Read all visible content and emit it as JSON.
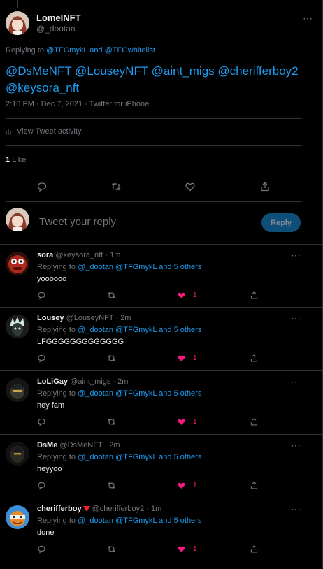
{
  "colors": {
    "accent": "#1d9bf0",
    "like": "#f91880",
    "muted": "#71767b",
    "text": "#e7e9ea",
    "background": "#000000"
  },
  "main_tweet": {
    "author_name": "LomeINFT",
    "author_handle": "@_dootan",
    "replying_prefix": "Replying to",
    "replying_targets": "@TFGmykL and @TFGwhitelist",
    "text_line1": "@DsMeNFT @LouseyNFT @aint_migs @cherifferboy2",
    "text_line2": "@keysora_nft",
    "meta": "2:10 PM · Dec 7, 2021 · Twitter for iPhone",
    "activity_label": "View Tweet activity",
    "like_count": "1",
    "like_label": "Like",
    "more_icon": "⋯"
  },
  "actions": {
    "reply_icon": "reply-icon",
    "retweet_icon": "retweet-icon",
    "like_icon": "heart-icon",
    "share_icon": "share-icon"
  },
  "composer": {
    "placeholder": "Tweet your reply",
    "button_label": "Reply"
  },
  "replies": [
    {
      "name": "sora",
      "handle": "@keysora_nft",
      "time": "· 1m",
      "replying_prefix": "Replying to",
      "replying_targets": "@_dootan @TFGmykL and 5 others",
      "text": "yoooooo",
      "like_count": "1"
    },
    {
      "name": "Lousey",
      "handle": "@LouseyNFT",
      "time": "· 2m",
      "replying_prefix": "Replying to",
      "replying_targets": "@_dootan @TFGmykL and 5 others",
      "text": "LFGGGGGGGGGGGGG",
      "like_count": "1"
    },
    {
      "name": "LoLiGay",
      "handle": "@aint_migs",
      "time": "· 2m",
      "replying_prefix": "Replying to",
      "replying_targets": "@_dootan @TFGmykL and 5 others",
      "text": "hey fam",
      "like_count": "1"
    },
    {
      "name": "DsMe",
      "handle": "@DsMeNFT",
      "time": "· 2m",
      "replying_prefix": "Replying to",
      "replying_targets": "@_dootan @TFGmykL and 5 others",
      "text": "heyyoo",
      "like_count": "1"
    },
    {
      "name": "cherifferboy",
      "handle": "@cherifferboy2",
      "time": "· 1m",
      "replying_prefix": "Replying to",
      "replying_targets": "@_dootan @TFGmykL and 5 others",
      "text": "done",
      "like_count": "1"
    }
  ]
}
